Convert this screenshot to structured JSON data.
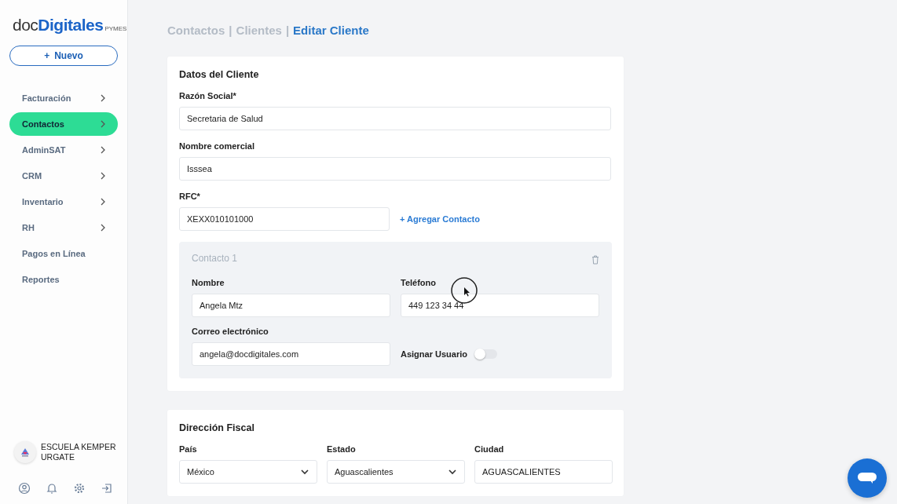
{
  "logo": {
    "prefix": "doc",
    "name": "Digitales",
    "suffix": "PYMES"
  },
  "new_button": {
    "icon": "+",
    "label": "Nuevo"
  },
  "sidebar": {
    "items": [
      {
        "label": "Facturación",
        "selected": false,
        "expandable": true
      },
      {
        "label": "Contactos",
        "selected": true,
        "expandable": true
      },
      {
        "label": "AdminSAT",
        "selected": false,
        "expandable": true
      },
      {
        "label": "CRM",
        "selected": false,
        "expandable": true
      },
      {
        "label": "Inventario",
        "selected": false,
        "expandable": true
      },
      {
        "label": "RH",
        "selected": false,
        "expandable": true
      },
      {
        "label": "Pagos en Línea",
        "selected": false,
        "expandable": false
      },
      {
        "label": "Reportes",
        "selected": false,
        "expandable": false
      }
    ]
  },
  "user": {
    "name": "ESCUELA KEMPER URGATE"
  },
  "breadcrumb": [
    {
      "label": "Contactos",
      "separator": "|",
      "current": false
    },
    {
      "label": "Clientes",
      "separator": "|",
      "current": false
    },
    {
      "label": "Editar Cliente",
      "current": true
    }
  ],
  "client_data": {
    "title": "Datos del Cliente",
    "fields": [
      {
        "label": "Razón Social*",
        "value": "Secretaria de Salud"
      },
      {
        "label": "Nombre comercial",
        "value": "Isssea"
      },
      {
        "label": "RFC*",
        "value": "XEXX010101000",
        "action": "+ Agregar Contacto"
      }
    ],
    "contacts": [
      {
        "title": "Contacto 1",
        "fields": [
          {
            "kind": "input",
            "label": "Nombre",
            "value": "Angela Mtz"
          },
          {
            "kind": "input",
            "label": "Teléfono",
            "value": "449 123 34 44"
          },
          {
            "kind": "input",
            "label": "Correo electrónico",
            "value": "angela@docdigitales.com"
          },
          {
            "kind": "toggle",
            "label": "Asignar Usuario",
            "on": false
          }
        ]
      }
    ]
  },
  "fiscal_address": {
    "title": "Dirección Fiscal",
    "fields": [
      {
        "kind": "select",
        "label": "País",
        "value": "México"
      },
      {
        "kind": "select",
        "label": "Estado",
        "value": "Aguascalientes"
      },
      {
        "kind": "input",
        "label": "Ciudad",
        "value": "AGUASCALIENTES"
      }
    ]
  }
}
